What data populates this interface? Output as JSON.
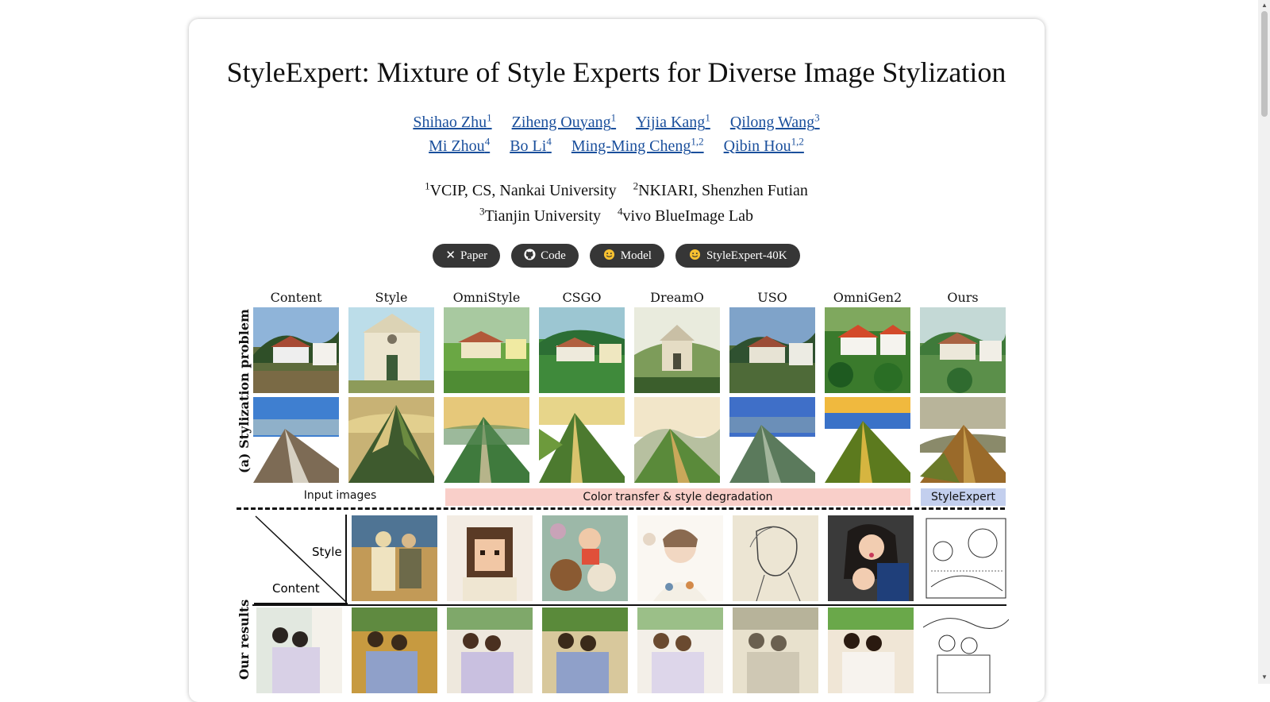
{
  "page": {
    "title": "StyleExpert: Mixture of Style Experts for Diverse Image Stylization",
    "authors_row1": [
      {
        "name": "Shihao Zhu",
        "sup": "1"
      },
      {
        "name": "Ziheng Ouyang",
        "sup": "1"
      },
      {
        "name": "Yijia Kang",
        "sup": "1"
      },
      {
        "name": "Qilong Wang",
        "sup": "3"
      }
    ],
    "authors_row2": [
      {
        "name": "Mi Zhou",
        "sup": "4"
      },
      {
        "name": "Bo Li",
        "sup": "4"
      },
      {
        "name": "Ming-Ming Cheng",
        "sup": "1,2"
      },
      {
        "name": "Qibin Hou",
        "sup": "1,2"
      }
    ],
    "affiliations_row1": [
      {
        "sup": "1",
        "name": "VCIP, CS, Nankai University"
      },
      {
        "sup": "2",
        "name": "NKIARI, Shenzhen Futian"
      }
    ],
    "affiliations_row2": [
      {
        "sup": "3",
        "name": "Tianjin University"
      },
      {
        "sup": "4",
        "name": "vivo BlueImage Lab"
      }
    ],
    "buttons": [
      {
        "label": "Paper",
        "icon": "arxiv-icon"
      },
      {
        "label": "Code",
        "icon": "github-icon"
      },
      {
        "label": "Model",
        "icon": "huggingface-icon"
      },
      {
        "label": "StyleExpert-40K",
        "icon": "huggingface-icon"
      }
    ]
  },
  "figure": {
    "column_headers": [
      "Content",
      "Style",
      "OmniStyle",
      "CSGO",
      "DreamO",
      "USO",
      "OmniGen2",
      "Ours"
    ],
    "row_label_a": "(a) Stylization problem",
    "row_label_b": "Our results",
    "banner_inputs": "Input images",
    "banner_degradation": "Color transfer & style degradation",
    "banner_ours": "StyleExpert",
    "diag_style": "Style",
    "diag_content": "Content"
  },
  "colors": {
    "link": "#1a4f9c",
    "button_bg": "#363636",
    "banner_red": "#f9cfc9",
    "banner_blue": "#c3cfee"
  }
}
